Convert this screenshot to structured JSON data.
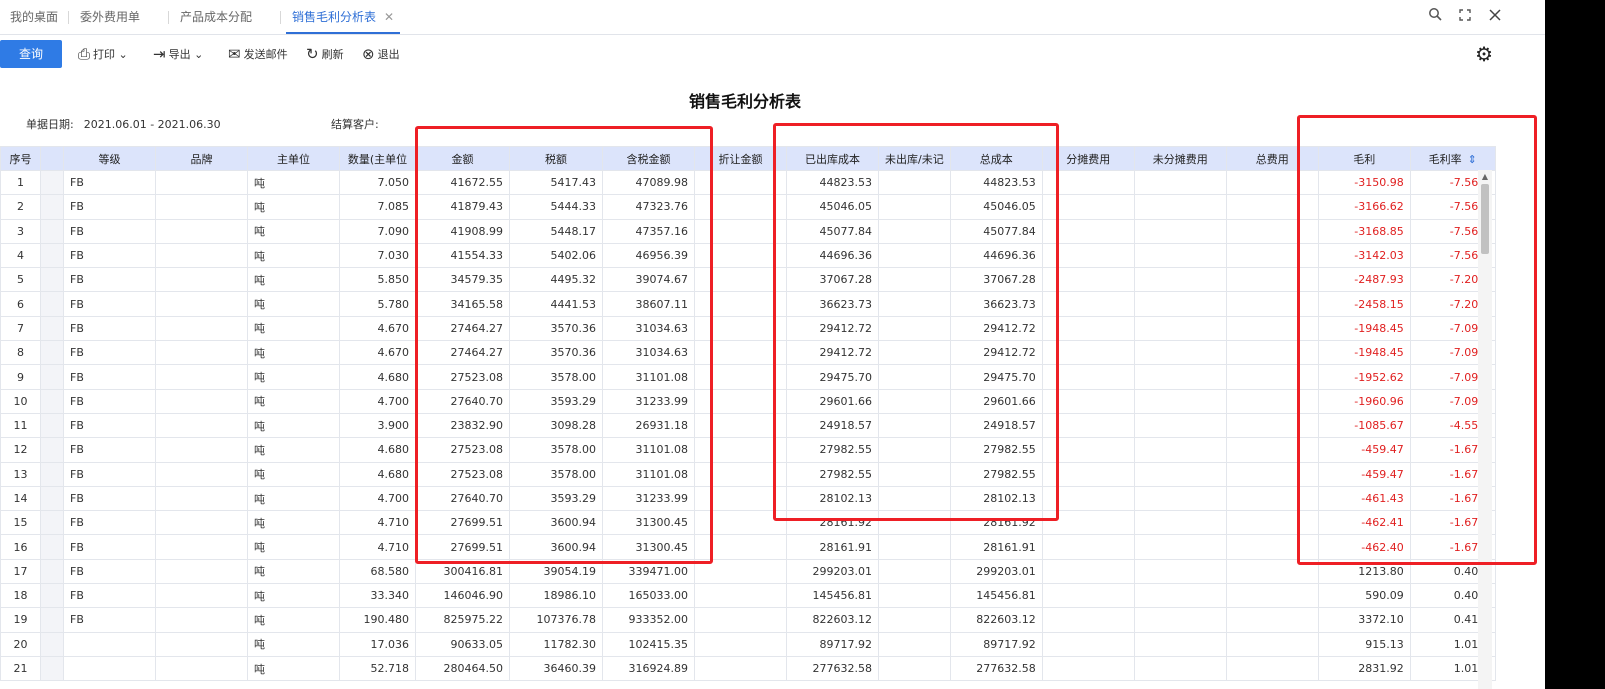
{
  "tabs": [
    {
      "label": "我的桌面",
      "active": false
    },
    {
      "label": "委外费用单",
      "active": false
    },
    {
      "label": "产品成本分配",
      "active": false
    },
    {
      "label": "销售毛利分析表",
      "active": true
    }
  ],
  "tab_close": "✕",
  "window_icons": {
    "search": "🔍",
    "restore": "❐",
    "close": "✕"
  },
  "toolbar": {
    "query_label": "查询",
    "print_label": "打印",
    "export_label": "导出",
    "email_label": "发送邮件",
    "refresh_label": "刷新",
    "exit_label": "退出",
    "settings_icon": "gear-icon"
  },
  "report": {
    "title": "销售毛利分析表",
    "date_label": "单据日期:",
    "date_value": "2021.06.01 - 2021.06.30",
    "customer_label": "结算客户:",
    "customer_value": ""
  },
  "table": {
    "columns": [
      "序号",
      "",
      "等级",
      "品牌",
      "主单位",
      "数量(主单位",
      "金额",
      "税额",
      "含税金额",
      "折让金额",
      "已出库成本",
      "未出库/未记",
      "总成本",
      "分摊费用",
      "未分摊费用",
      "总费用",
      "毛利",
      "毛利率"
    ],
    "sort_indicator": "⇕",
    "rows": [
      [
        "1",
        "",
        "FB",
        "",
        "吨",
        "7.050",
        "41672.55",
        "5417.43",
        "47089.98",
        "",
        "44823.53",
        "",
        "44823.53",
        "",
        "",
        "",
        "-3150.98",
        "-7.56%"
      ],
      [
        "2",
        "",
        "FB",
        "",
        "吨",
        "7.085",
        "41879.43",
        "5444.33",
        "47323.76",
        "",
        "45046.05",
        "",
        "45046.05",
        "",
        "",
        "",
        "-3166.62",
        "-7.56%"
      ],
      [
        "3",
        "",
        "FB",
        "",
        "吨",
        "7.090",
        "41908.99",
        "5448.17",
        "47357.16",
        "",
        "45077.84",
        "",
        "45077.84",
        "",
        "",
        "",
        "-3168.85",
        "-7.56%"
      ],
      [
        "4",
        "",
        "FB",
        "",
        "吨",
        "7.030",
        "41554.33",
        "5402.06",
        "46956.39",
        "",
        "44696.36",
        "",
        "44696.36",
        "",
        "",
        "",
        "-3142.03",
        "-7.56%"
      ],
      [
        "5",
        "",
        "FB",
        "",
        "吨",
        "5.850",
        "34579.35",
        "4495.32",
        "39074.67",
        "",
        "37067.28",
        "",
        "37067.28",
        "",
        "",
        "",
        "-2487.93",
        "-7.20%"
      ],
      [
        "6",
        "",
        "FB",
        "",
        "吨",
        "5.780",
        "34165.58",
        "4441.53",
        "38607.11",
        "",
        "36623.73",
        "",
        "36623.73",
        "",
        "",
        "",
        "-2458.15",
        "-7.20%"
      ],
      [
        "7",
        "",
        "FB",
        "",
        "吨",
        "4.670",
        "27464.27",
        "3570.36",
        "31034.63",
        "",
        "29412.72",
        "",
        "29412.72",
        "",
        "",
        "",
        "-1948.45",
        "-7.09%"
      ],
      [
        "8",
        "",
        "FB",
        "",
        "吨",
        "4.670",
        "27464.27",
        "3570.36",
        "31034.63",
        "",
        "29412.72",
        "",
        "29412.72",
        "",
        "",
        "",
        "-1948.45",
        "-7.09%"
      ],
      [
        "9",
        "",
        "FB",
        "",
        "吨",
        "4.680",
        "27523.08",
        "3578.00",
        "31101.08",
        "",
        "29475.70",
        "",
        "29475.70",
        "",
        "",
        "",
        "-1952.62",
        "-7.09%"
      ],
      [
        "10",
        "",
        "FB",
        "",
        "吨",
        "4.700",
        "27640.70",
        "3593.29",
        "31233.99",
        "",
        "29601.66",
        "",
        "29601.66",
        "",
        "",
        "",
        "-1960.96",
        "-7.09%"
      ],
      [
        "11",
        "",
        "FB",
        "",
        "吨",
        "3.900",
        "23832.90",
        "3098.28",
        "26931.18",
        "",
        "24918.57",
        "",
        "24918.57",
        "",
        "",
        "",
        "-1085.67",
        "-4.55%"
      ],
      [
        "12",
        "",
        "FB",
        "",
        "吨",
        "4.680",
        "27523.08",
        "3578.00",
        "31101.08",
        "",
        "27982.55",
        "",
        "27982.55",
        "",
        "",
        "",
        "-459.47",
        "-1.67%"
      ],
      [
        "13",
        "",
        "FB",
        "",
        "吨",
        "4.680",
        "27523.08",
        "3578.00",
        "31101.08",
        "",
        "27982.55",
        "",
        "27982.55",
        "",
        "",
        "",
        "-459.47",
        "-1.67%"
      ],
      [
        "14",
        "",
        "FB",
        "",
        "吨",
        "4.700",
        "27640.70",
        "3593.29",
        "31233.99",
        "",
        "28102.13",
        "",
        "28102.13",
        "",
        "",
        "",
        "-461.43",
        "-1.67%"
      ],
      [
        "15",
        "",
        "FB",
        "",
        "吨",
        "4.710",
        "27699.51",
        "3600.94",
        "31300.45",
        "",
        "28161.92",
        "",
        "28161.92",
        "",
        "",
        "",
        "-462.41",
        "-1.67%"
      ],
      [
        "16",
        "",
        "FB",
        "",
        "吨",
        "4.710",
        "27699.51",
        "3600.94",
        "31300.45",
        "",
        "28161.91",
        "",
        "28161.91",
        "",
        "",
        "",
        "-462.40",
        "-1.67%"
      ],
      [
        "17",
        "",
        "FB",
        "",
        "吨",
        "68.580",
        "300416.81",
        "39054.19",
        "339471.00",
        "",
        "299203.01",
        "",
        "299203.01",
        "",
        "",
        "",
        "1213.80",
        "0.40%"
      ],
      [
        "18",
        "",
        "FB",
        "",
        "吨",
        "33.340",
        "146046.90",
        "18986.10",
        "165033.00",
        "",
        "145456.81",
        "",
        "145456.81",
        "",
        "",
        "",
        "590.09",
        "0.40%"
      ],
      [
        "19",
        "",
        "FB",
        "",
        "吨",
        "190.480",
        "825975.22",
        "107376.78",
        "933352.00",
        "",
        "822603.12",
        "",
        "822603.12",
        "",
        "",
        "",
        "3372.10",
        "0.41%"
      ],
      [
        "20",
        "",
        "",
        "",
        "吨",
        "17.036",
        "90633.05",
        "11782.30",
        "102415.35",
        "",
        "89717.92",
        "",
        "89717.92",
        "",
        "",
        "",
        "915.13",
        "1.01%"
      ],
      [
        "21",
        "",
        "",
        "",
        "吨",
        "52.718",
        "280464.50",
        "36460.39",
        "316924.89",
        "",
        "277632.58",
        "",
        "277632.58",
        "",
        "",
        "",
        "2831.92",
        "1.01%"
      ]
    ]
  },
  "colors": {
    "accent": "#2f7be5",
    "header_bg": "#dce4fb",
    "negative": "#e02020",
    "annotation": "#ee1f25"
  }
}
